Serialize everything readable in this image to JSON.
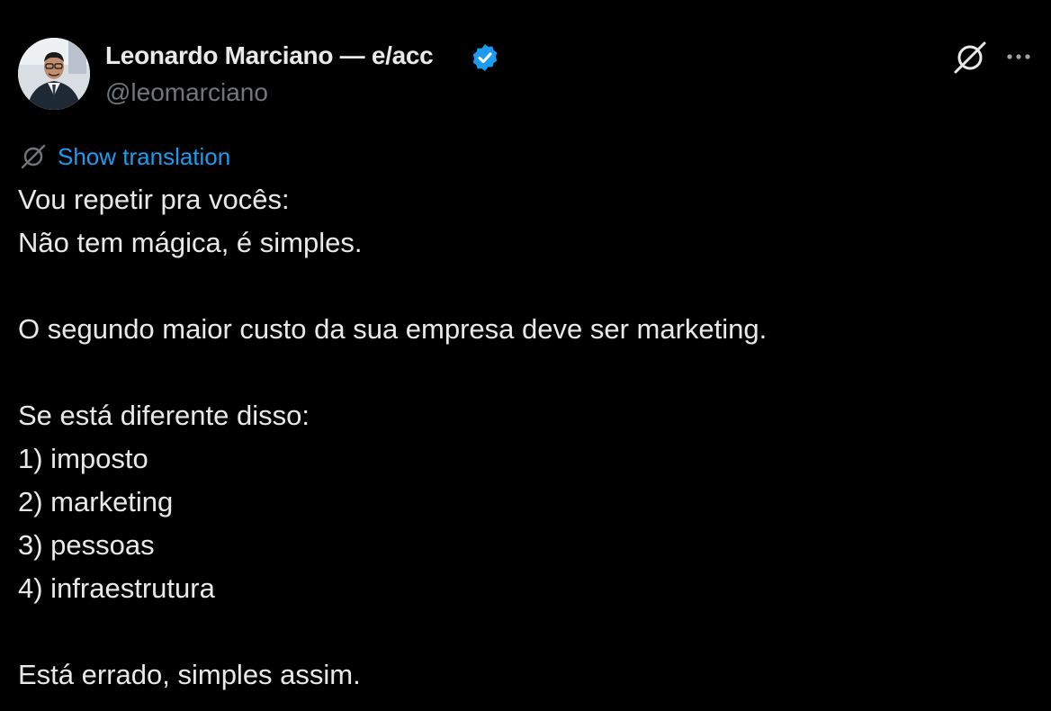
{
  "author": {
    "name": "Leonardo Marciano — e/acc",
    "handle": "@leomarciano",
    "verified_icon": "verified-badge-icon",
    "verified_color": "#1d9bf0"
  },
  "actions": {
    "grok_icon": "grok-icon",
    "more_icon": "more-horizontal-icon"
  },
  "translation": {
    "icon": "grok-icon",
    "label": "Show translation",
    "color": "#1d9bf0"
  },
  "tweet": {
    "lines": [
      "Vou repetir pra vocês:",
      "Não tem mágica, é simples.",
      "",
      "O segundo maior custo da sua empresa deve ser marketing.",
      "",
      "Se está diferente disso:",
      "1) imposto",
      "2) marketing",
      "3) pessoas",
      "4) infraestrutura",
      "",
      "Está errado, simples assim."
    ]
  },
  "colors": {
    "background": "#000000",
    "text": "#e7e9ea",
    "secondary_text": "#71767b",
    "link": "#1d9bf0"
  }
}
